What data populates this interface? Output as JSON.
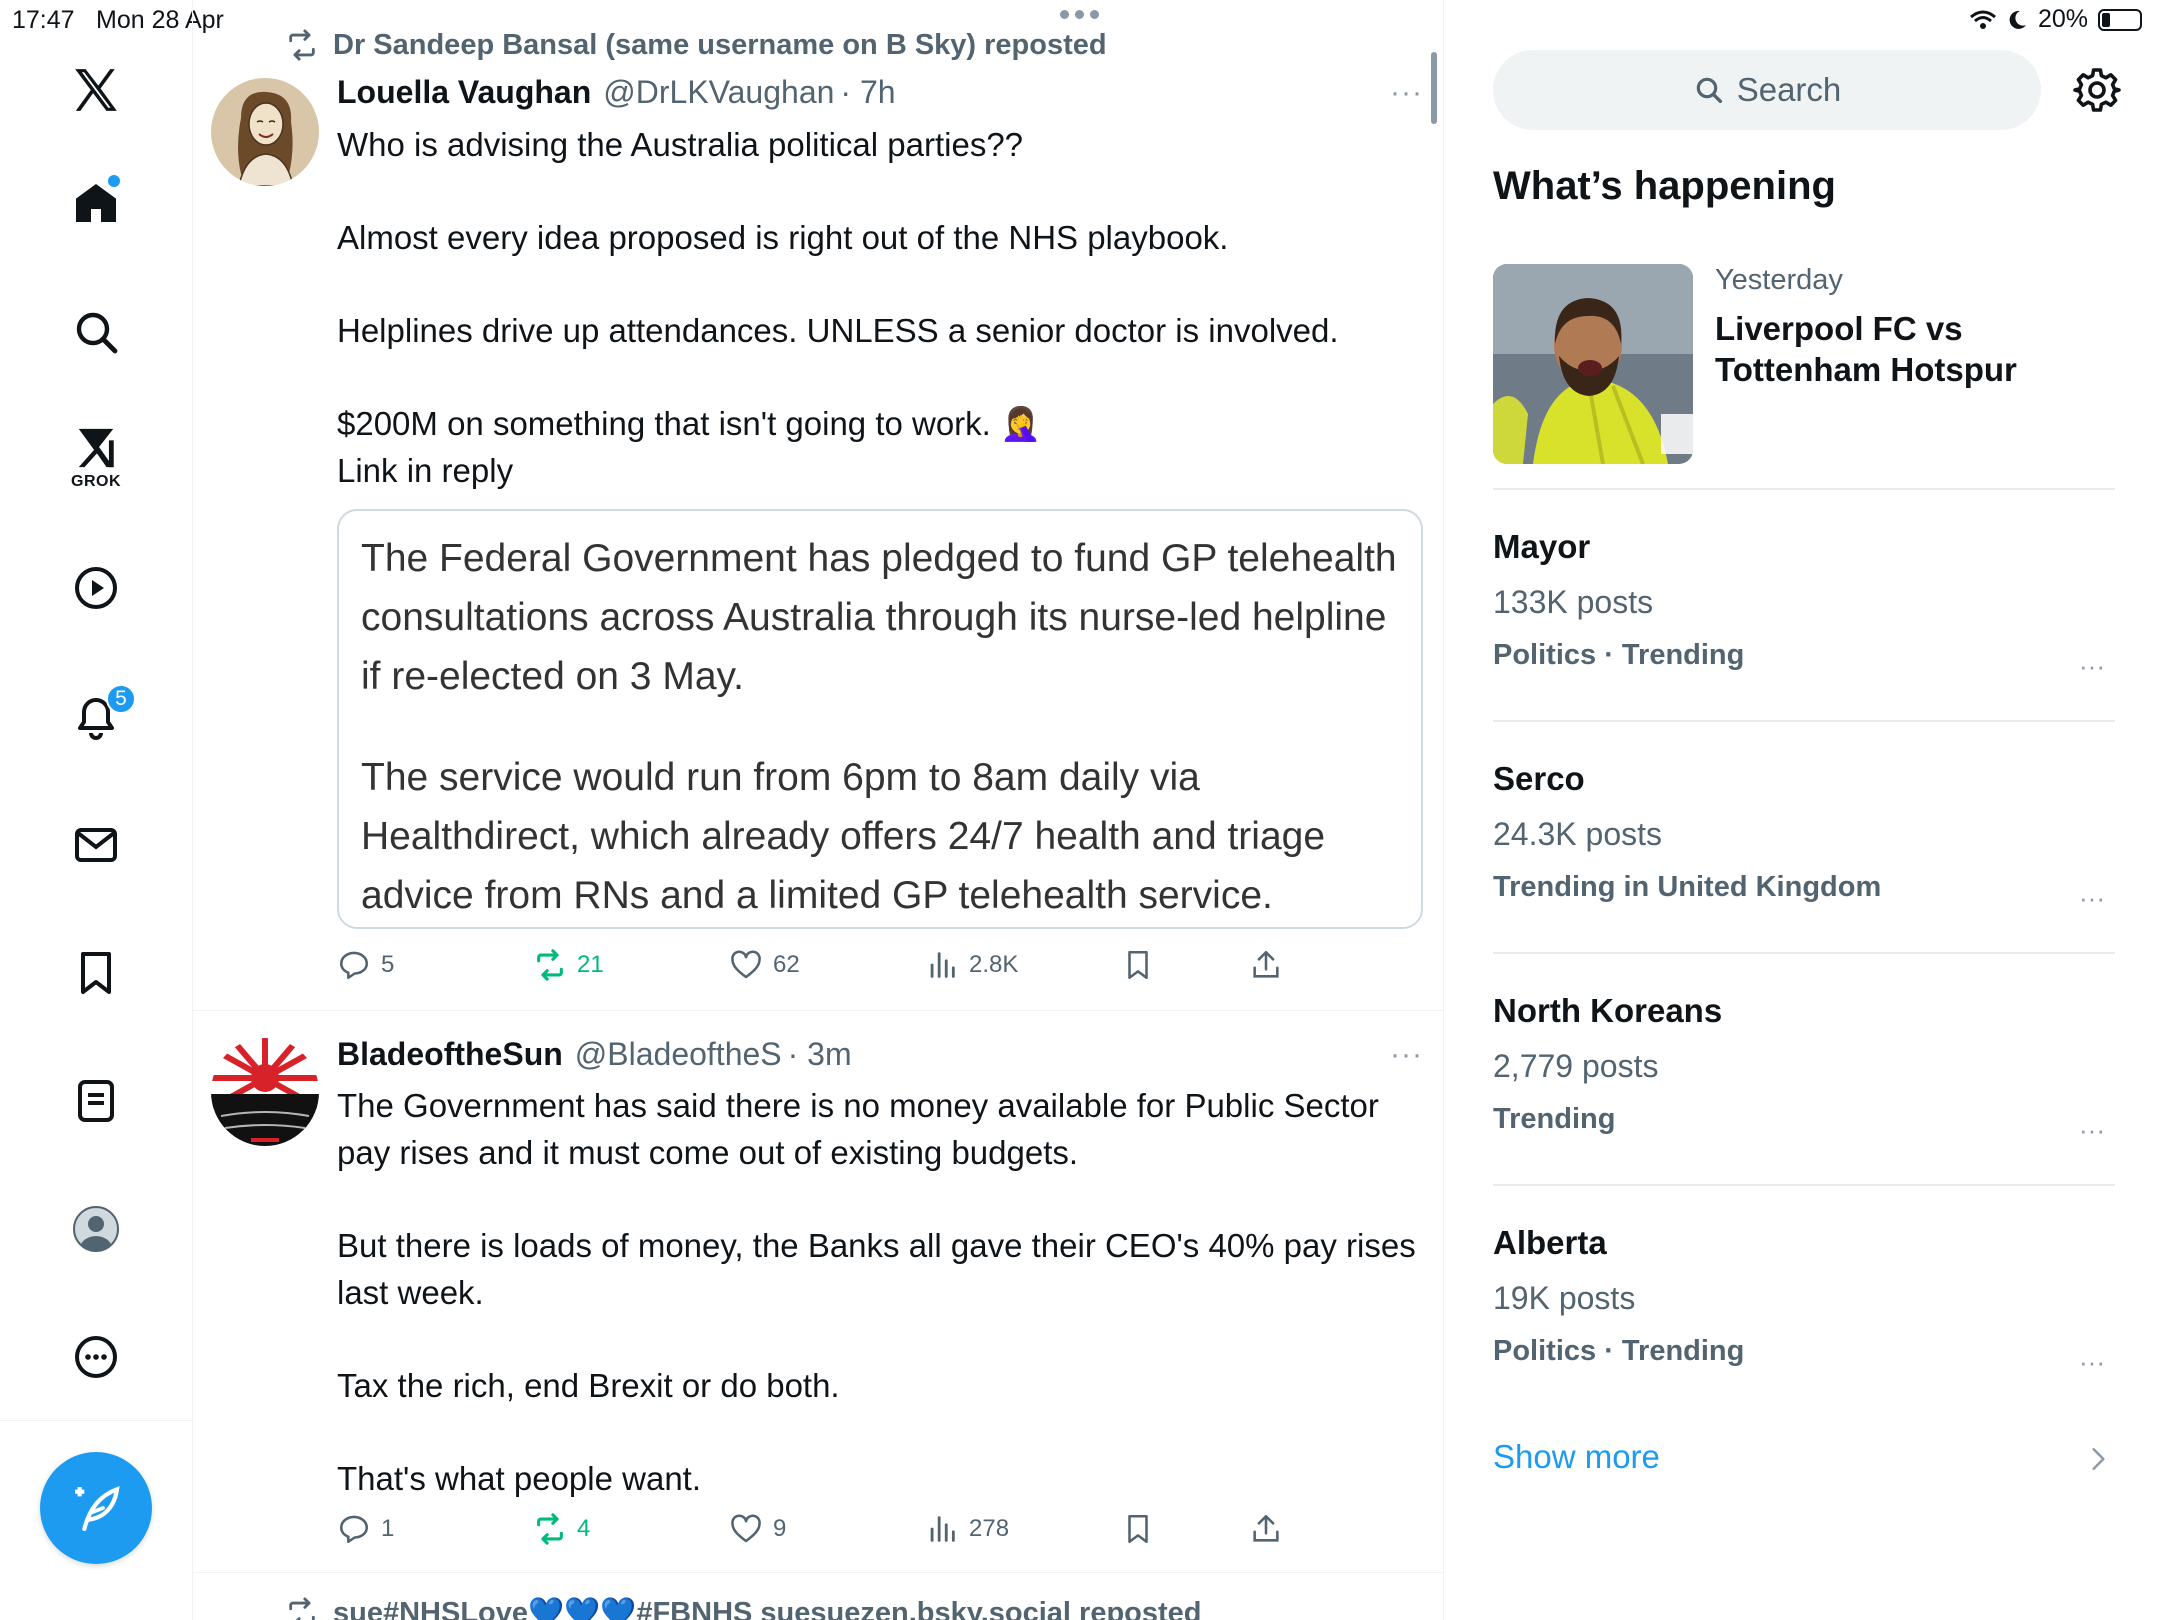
{
  "status_bar": {
    "time": "17:47",
    "date": "Mon 28 Apr",
    "battery": "20%"
  },
  "nav": {
    "items": [
      "home-icon",
      "search-icon",
      "grok-icon",
      "video-icon",
      "notifications-icon",
      "messages-icon",
      "bookmarks-icon",
      "lists-icon",
      "profile-icon",
      "more-icon"
    ],
    "grok_label": "GROK",
    "notifications_badge": "5"
  },
  "feed": {
    "tweets": [
      {
        "repost_by": "Dr Sandeep Bansal (same username on B Sky) reposted",
        "name": "Louella Vaughan",
        "handle": "@DrLKVaughan",
        "time": "· 7h",
        "more": "···",
        "body": [
          "Who is advising the Australia political parties??",
          "Almost every idea proposed is right out of the NHS playbook.",
          "Helplines drive up attendances. UNLESS a senior doctor is involved.",
          "$200M on something that isn't going to work. 🤦‍♀️",
          "Link in reply"
        ],
        "card": [
          "The Federal Government has pledged to fund GP telehealth consultations across Australia through its nurse-led helpline if re-elected on 3 May.",
          "The service would run from 6pm to 8am daily via Healthdirect, which already offers 24/7 health and triage advice from RNs and a limited GP telehealth service."
        ],
        "replies": "5",
        "reposts": "21",
        "likes": "62",
        "views": "2.8K"
      },
      {
        "name": "BladeoftheSun",
        "handle": "@BladeoftheS",
        "time": "· 3m",
        "more": "···",
        "body": [
          "The Government has said there is no money available for Public Sector pay rises and it must come out of existing budgets.",
          "But there is loads of money, the Banks all gave their CEO's 40% pay rises last week.",
          "Tax the rich, end Brexit or do both.",
          "That's what people want."
        ],
        "replies": "1",
        "reposts": "4",
        "likes": "9",
        "views": "278"
      }
    ],
    "next_repost": "sue#NHSLove💙💙💙#FBNHS suesuezen.bsky.social reposted"
  },
  "sidebar": {
    "search_placeholder": "Search",
    "title": "What’s happening",
    "event": {
      "when": "Yesterday",
      "title": "Liverpool FC vs Tottenham Hotspur"
    },
    "trends": [
      {
        "topic": "Mayor",
        "posts": "133K posts",
        "context": "Politics · Trending"
      },
      {
        "topic": "Serco",
        "posts": "24.3K posts",
        "context": "Trending in United Kingdom"
      },
      {
        "topic": "North Koreans",
        "posts": "2,779 posts",
        "context": "Trending"
      },
      {
        "topic": "Alberta",
        "posts": "19K posts",
        "context": "Politics · Trending"
      }
    ],
    "trend_more": "···",
    "show_more": "Show more"
  },
  "colors": {
    "accent": "#1d9bf0",
    "repost_green": "#00ba7c",
    "secondary_text": "#536471"
  }
}
